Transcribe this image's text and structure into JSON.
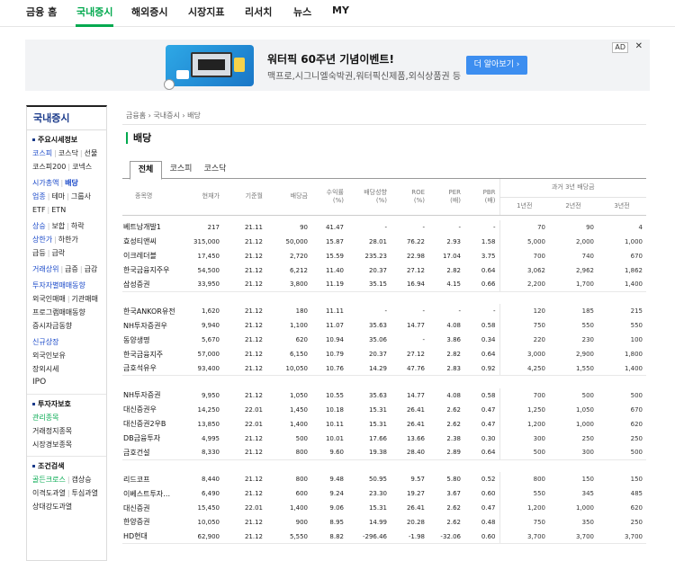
{
  "topnav": {
    "items": [
      "금융 홈",
      "국내증시",
      "해외증시",
      "시장지표",
      "리서치",
      "뉴스",
      "MY"
    ]
  },
  "ad": {
    "title": "워터픽 60주년 기념이벤트!",
    "subtitle": "맥프로,시그니엘숙박권,워터픽신제품,외식상품권 등",
    "cta": "더 알아보기 ›",
    "label": "AD",
    "close": "✕"
  },
  "sidebar": {
    "title": "국내증시",
    "main_info_title": "주요시세정보",
    "l1": [
      "코스피",
      "코스닥",
      "선물"
    ],
    "l2": [
      "코스피200",
      "코넥스"
    ],
    "l3": [
      "시가총액",
      "배당"
    ],
    "l4": [
      "업종",
      "테마",
      "그룹사"
    ],
    "l5": [
      "ETF",
      "ETN"
    ],
    "l6": [
      "상승",
      "보합",
      "하락"
    ],
    "l7": [
      "상한가",
      "하한가"
    ],
    "l8": [
      "급등",
      "급락"
    ],
    "l9": [
      "거래상위",
      "급증",
      "급감"
    ],
    "investor_title": "투자자별매매동향",
    "l10": [
      "외국인매매",
      "기관매매"
    ],
    "l11": "프로그램매매동향",
    "l12": "증시자금동향",
    "new_listing": "신규상장",
    "l13": "외국인보유",
    "l14": "장외시세",
    "l15": "IPO",
    "caution_title": "투자자보호",
    "l16": "관리종목",
    "l17": "거래정지종목",
    "l18": "시장경보종목",
    "cond_title": "조건검색",
    "l19": [
      "골든크로스",
      "갭상승"
    ],
    "l20": [
      "이격도과열",
      "투심과열"
    ],
    "l21": "상대강도과열"
  },
  "main": {
    "breadcrumb": "금융홈 › 국내증시 › 배당",
    "title": "배당",
    "tabs": [
      "전체",
      "코스피",
      "코스닥"
    ]
  },
  "table": {
    "headers": {
      "name": "종목명",
      "price": "현재가",
      "base_month": "기준월",
      "dividend": "배당금",
      "yield": "수익률\n(%)",
      "payout": "배당성향\n(%)",
      "roe": "ROE\n(%)",
      "per": "PER\n(배)",
      "pbr": "PBR\n(배)",
      "hist_group": "과거 3년 배당금",
      "hist": [
        "1년전",
        "2년전",
        "3년전"
      ]
    },
    "groups": [
      [
        [
          "베트남개발1",
          "217",
          "21.11",
          "90",
          "41.47",
          "-",
          "-",
          "-",
          "-",
          "70",
          "90",
          "4"
        ],
        [
          "효성티앤씨",
          "315,000",
          "21.12",
          "50,000",
          "15.87",
          "28.01",
          "76.22",
          "2.93",
          "1.58",
          "5,000",
          "2,000",
          "1,000"
        ],
        [
          "이크레더블",
          "17,450",
          "21.12",
          "2,720",
          "15.59",
          "235.23",
          "22.98",
          "17.04",
          "3.75",
          "700",
          "740",
          "670"
        ],
        [
          "한국금융지주우",
          "54,500",
          "21.12",
          "6,212",
          "11.40",
          "20.37",
          "27.12",
          "2.82",
          "0.64",
          "3,062",
          "2,962",
          "1,862"
        ],
        [
          "삼성증권",
          "33,950",
          "21.12",
          "3,800",
          "11.19",
          "35.15",
          "16.94",
          "4.15",
          "0.66",
          "2,200",
          "1,700",
          "1,400"
        ]
      ],
      [
        [
          "한국ANKOR유전",
          "1,620",
          "21.12",
          "180",
          "11.11",
          "-",
          "-",
          "-",
          "-",
          "120",
          "185",
          "215"
        ],
        [
          "NH투자증권우",
          "9,940",
          "21.12",
          "1,100",
          "11.07",
          "35.63",
          "14.77",
          "4.08",
          "0.58",
          "750",
          "550",
          "550"
        ],
        [
          "동양생명",
          "5,670",
          "21.12",
          "620",
          "10.94",
          "35.06",
          "-",
          "3.86",
          "0.34",
          "220",
          "230",
          "100"
        ],
        [
          "한국금융지주",
          "57,000",
          "21.12",
          "6,150",
          "10.79",
          "20.37",
          "27.12",
          "2.82",
          "0.64",
          "3,000",
          "2,900",
          "1,800"
        ],
        [
          "금호석유우",
          "93,400",
          "21.12",
          "10,050",
          "10.76",
          "14.29",
          "47.76",
          "2.83",
          "0.92",
          "4,250",
          "1,550",
          "1,400"
        ]
      ],
      [
        [
          "NH투자증권",
          "9,950",
          "21.12",
          "1,050",
          "10.55",
          "35.63",
          "14.77",
          "4.08",
          "0.58",
          "700",
          "500",
          "500"
        ],
        [
          "대신증권우",
          "14,250",
          "22.01",
          "1,450",
          "10.18",
          "15.31",
          "26.41",
          "2.62",
          "0.47",
          "1,250",
          "1,050",
          "670"
        ],
        [
          "대신증권2우B",
          "13,850",
          "22.01",
          "1,400",
          "10.11",
          "15.31",
          "26.41",
          "2.62",
          "0.47",
          "1,200",
          "1,000",
          "620"
        ],
        [
          "DB금융투자",
          "4,995",
          "21.12",
          "500",
          "10.01",
          "17.66",
          "13.66",
          "2.38",
          "0.30",
          "300",
          "250",
          "250"
        ],
        [
          "금호건설",
          "8,330",
          "21.12",
          "800",
          "9.60",
          "19.38",
          "28.40",
          "2.89",
          "0.64",
          "500",
          "300",
          "500"
        ]
      ],
      [
        [
          "리드코프",
          "8,440",
          "21.12",
          "800",
          "9.48",
          "50.95",
          "9.57",
          "5.80",
          "0.52",
          "800",
          "150",
          "150"
        ],
        [
          "이베스트투자…",
          "6,490",
          "21.12",
          "600",
          "9.24",
          "23.30",
          "19.27",
          "3.67",
          "0.60",
          "550",
          "345",
          "485"
        ],
        [
          "대신증권",
          "15,450",
          "22.01",
          "1,400",
          "9.06",
          "15.31",
          "26.41",
          "2.62",
          "0.47",
          "1,200",
          "1,000",
          "620"
        ],
        [
          "한양증권",
          "10,050",
          "21.12",
          "900",
          "8.95",
          "14.99",
          "20.28",
          "2.62",
          "0.48",
          "750",
          "350",
          "250"
        ],
        [
          "HD현대",
          "62,900",
          "21.12",
          "5,550",
          "8.82",
          "-296.46",
          "-1.98",
          "-32.06",
          "0.60",
          "3,700",
          "3,700",
          "3,700"
        ]
      ]
    ]
  }
}
